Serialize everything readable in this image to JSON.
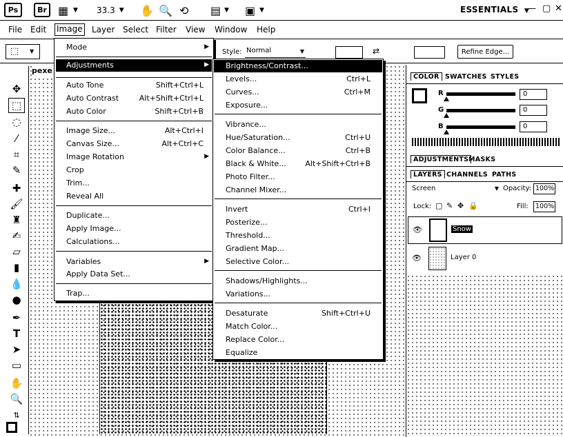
{
  "appbar": {
    "ps": "Ps",
    "br": "Br",
    "zoom": "33.3",
    "workspace": "ESSENTIALS"
  },
  "menubar": [
    "File",
    "Edit",
    "Image",
    "Layer",
    "Select",
    "Filter",
    "View",
    "Window",
    "Help"
  ],
  "options": {
    "style_label": "Style:",
    "style_value": "Normal",
    "refine_edge": "Refine Edge..."
  },
  "document": {
    "tab_label": "pexe"
  },
  "image_menu": {
    "mode": "Mode",
    "adjustments": "Adjustments",
    "items": [
      {
        "label": "Auto Tone",
        "shortcut": "Shift+Ctrl+L"
      },
      {
        "label": "Auto Contrast",
        "shortcut": "Alt+Shift+Ctrl+L"
      },
      {
        "label": "Auto Color",
        "shortcut": "Shift+Ctrl+B"
      },
      {
        "label": "Image Size...",
        "shortcut": "Alt+Ctrl+I"
      },
      {
        "label": "Canvas Size...",
        "shortcut": "Alt+Ctrl+C"
      },
      {
        "label": "Image Rotation",
        "shortcut": ""
      },
      {
        "label": "Crop",
        "shortcut": ""
      },
      {
        "label": "Trim...",
        "shortcut": ""
      },
      {
        "label": "Reveal All",
        "shortcut": ""
      },
      {
        "label": "Duplicate...",
        "shortcut": ""
      },
      {
        "label": "Apply Image...",
        "shortcut": ""
      },
      {
        "label": "Calculations...",
        "shortcut": ""
      },
      {
        "label": "Variables",
        "shortcut": ""
      },
      {
        "label": "Apply Data Set...",
        "shortcut": ""
      },
      {
        "label": "Trap...",
        "shortcut": ""
      }
    ]
  },
  "adjust_menu": {
    "highlighted": "Brightness/Contrast...",
    "items": [
      {
        "label": "Levels...",
        "shortcut": "Ctrl+L"
      },
      {
        "label": "Curves...",
        "shortcut": "Ctrl+M"
      },
      {
        "label": "Exposure...",
        "shortcut": ""
      },
      {
        "label": "Vibrance...",
        "shortcut": ""
      },
      {
        "label": "Hue/Saturation...",
        "shortcut": "Ctrl+U"
      },
      {
        "label": "Color Balance...",
        "shortcut": "Ctrl+B"
      },
      {
        "label": "Black & White...",
        "shortcut": "Alt+Shift+Ctrl+B"
      },
      {
        "label": "Photo Filter...",
        "shortcut": ""
      },
      {
        "label": "Channel Mixer...",
        "shortcut": ""
      },
      {
        "label": "Invert",
        "shortcut": "Ctrl+I"
      },
      {
        "label": "Posterize...",
        "shortcut": ""
      },
      {
        "label": "Threshold...",
        "shortcut": ""
      },
      {
        "label": "Gradient Map...",
        "shortcut": ""
      },
      {
        "label": "Selective Color...",
        "shortcut": ""
      },
      {
        "label": "Shadows/Highlights...",
        "shortcut": ""
      },
      {
        "label": "Variations...",
        "shortcut": ""
      },
      {
        "label": "Desaturate",
        "shortcut": "Shift+Ctrl+U"
      },
      {
        "label": "Match Color...",
        "shortcut": ""
      },
      {
        "label": "Replace Color...",
        "shortcut": ""
      },
      {
        "label": "Equalize",
        "shortcut": ""
      }
    ]
  },
  "color_panel": {
    "tabs": [
      "COLOR",
      "SWATCHES",
      "STYLES"
    ],
    "r_label": "R",
    "g_label": "G",
    "b_label": "B",
    "r": "0",
    "g": "0",
    "b": "0"
  },
  "adjust_panel": {
    "tabs": [
      "ADJUSTMENTS",
      "MASKS"
    ]
  },
  "layers_panel": {
    "tabs": [
      "LAYERS",
      "CHANNELS",
      "PATHS"
    ],
    "blend_mode": "Screen",
    "opacity_label": "Opacity:",
    "opacity": "100%",
    "lock_label": "Lock:",
    "fill_label": "Fill:",
    "fill": "100%",
    "layers": [
      "Snow",
      "Layer 0"
    ]
  },
  "icons": [
    "move-icon",
    "marquee-icon",
    "lasso-icon",
    "quick-select-icon",
    "crop-icon",
    "eyedropper-icon",
    "healing-icon",
    "brush-icon",
    "clone-stamp-icon",
    "history-brush-icon",
    "eraser-icon",
    "gradient-icon",
    "blur-icon",
    "dodge-icon",
    "pen-icon",
    "type-icon",
    "path-select-icon",
    "shape-icon",
    "hand-icon",
    "zoom-icon"
  ]
}
